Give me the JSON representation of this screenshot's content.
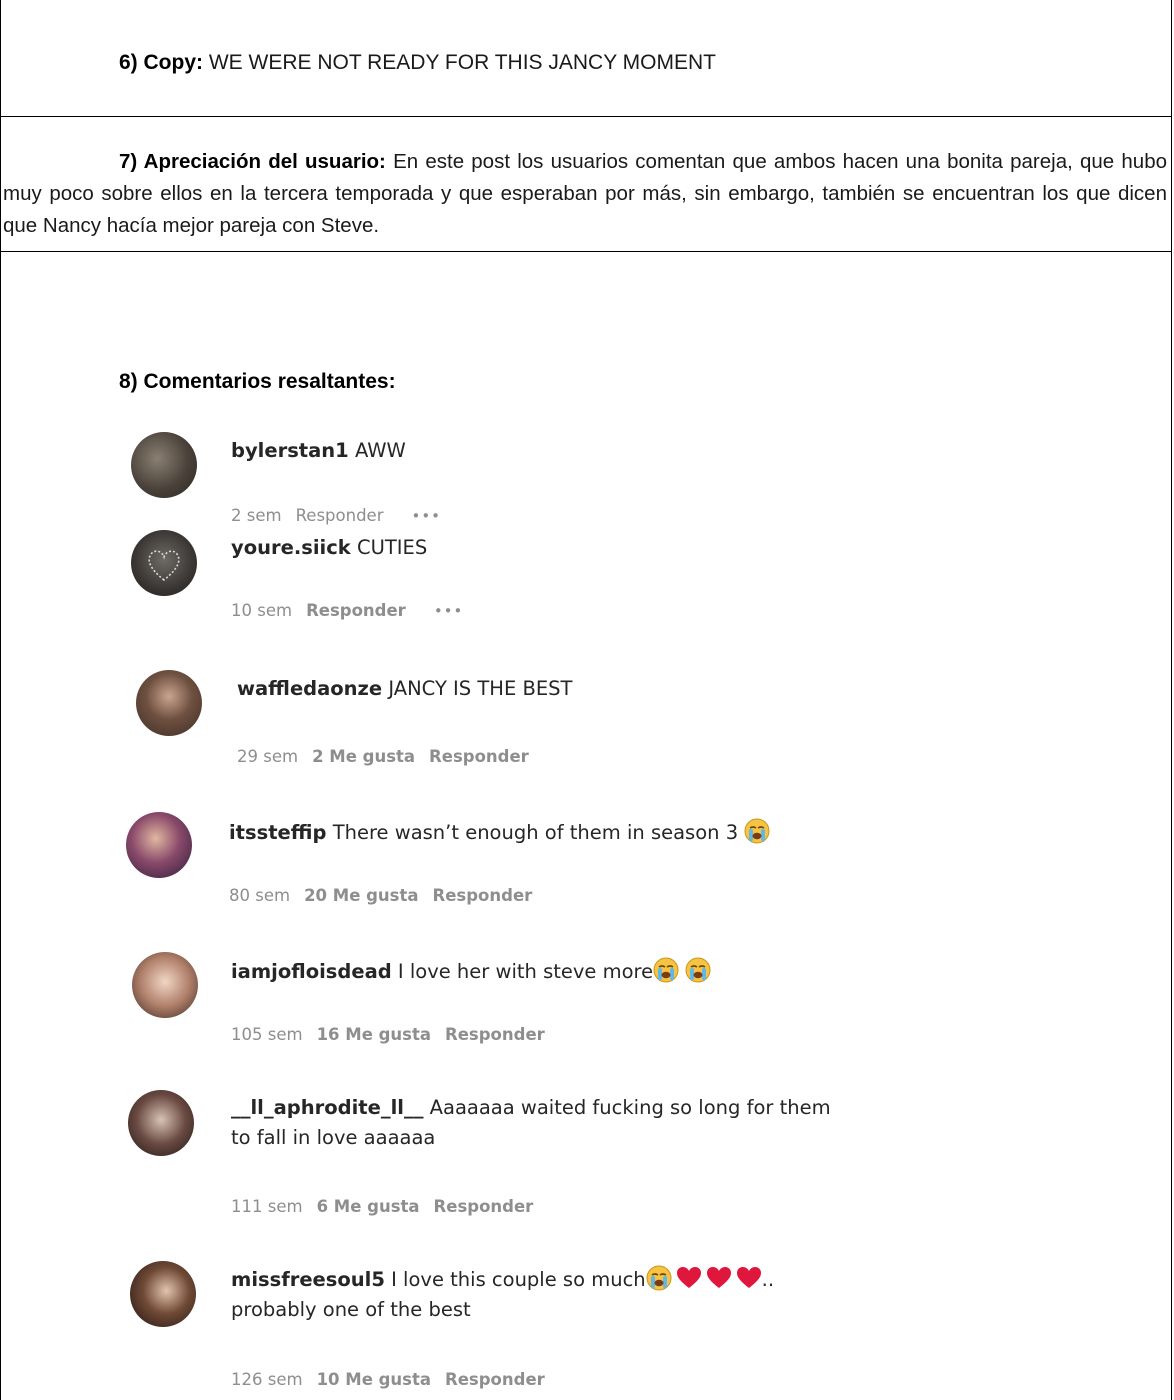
{
  "copy": {
    "label": "6) Copy:",
    "text": "WE WERE NOT READY FOR THIS JANCY MOMENT"
  },
  "appreciation": {
    "label": "7) Apreciación del usuario:",
    "text": "En este post los usuarios comentan que ambos hacen una bonita pareja, que hubo muy poco sobre ellos en la tercera temporada y que esperaban por más, sin embargo, también se encuentran los que dicen que Nancy hacía mejor pareja con Steve."
  },
  "comments_section": {
    "title": "8) Comentarios resaltantes:"
  },
  "comments": [
    {
      "user": "bylerstan1",
      "text": "AWW",
      "time": "2 sem",
      "likes": "",
      "reply": "Responder",
      "more": "•••"
    },
    {
      "user": "youre.siick",
      "text": "CUTIES",
      "time": "10 sem",
      "likes": "",
      "reply": "Responder",
      "more": "•••"
    },
    {
      "user": "waffledaonze",
      "text": "JANCY IS THE BEST",
      "time": "29 sem",
      "likes": "2 Me gusta",
      "reply": "Responder"
    },
    {
      "user": "itssteffip",
      "text": "There wasn’t enough of them in season 3",
      "time": "80 sem",
      "likes": "20 Me gusta",
      "reply": "Responder"
    },
    {
      "user": "iamjofloisdead",
      "text": "I love her with steve more",
      "time": "105 sem",
      "likes": "16 Me gusta",
      "reply": "Responder"
    },
    {
      "user": "__ll_aphrodite_ll__",
      "text": "Aaaaaaa waited fucking so long for them",
      "text2": "to fall in love aaaaaa",
      "time": "111 sem",
      "likes": "6 Me gusta",
      "reply": "Responder"
    },
    {
      "user": "missfreesoul5",
      "text": "I love this couple so much",
      "text_tail": "..",
      "text2": "probably one of the best",
      "time": "126 sem",
      "likes": "10 Me gusta",
      "reply": "Responder"
    }
  ],
  "icons": {
    "cry": "crying-face-emoji",
    "heart": "red-heart-emoji",
    "avatar": "profile-avatar"
  },
  "colors": {
    "username": "#262626",
    "meta": "#8e8e8e",
    "heart": "#e0173d",
    "emoji": "#f4c430"
  }
}
